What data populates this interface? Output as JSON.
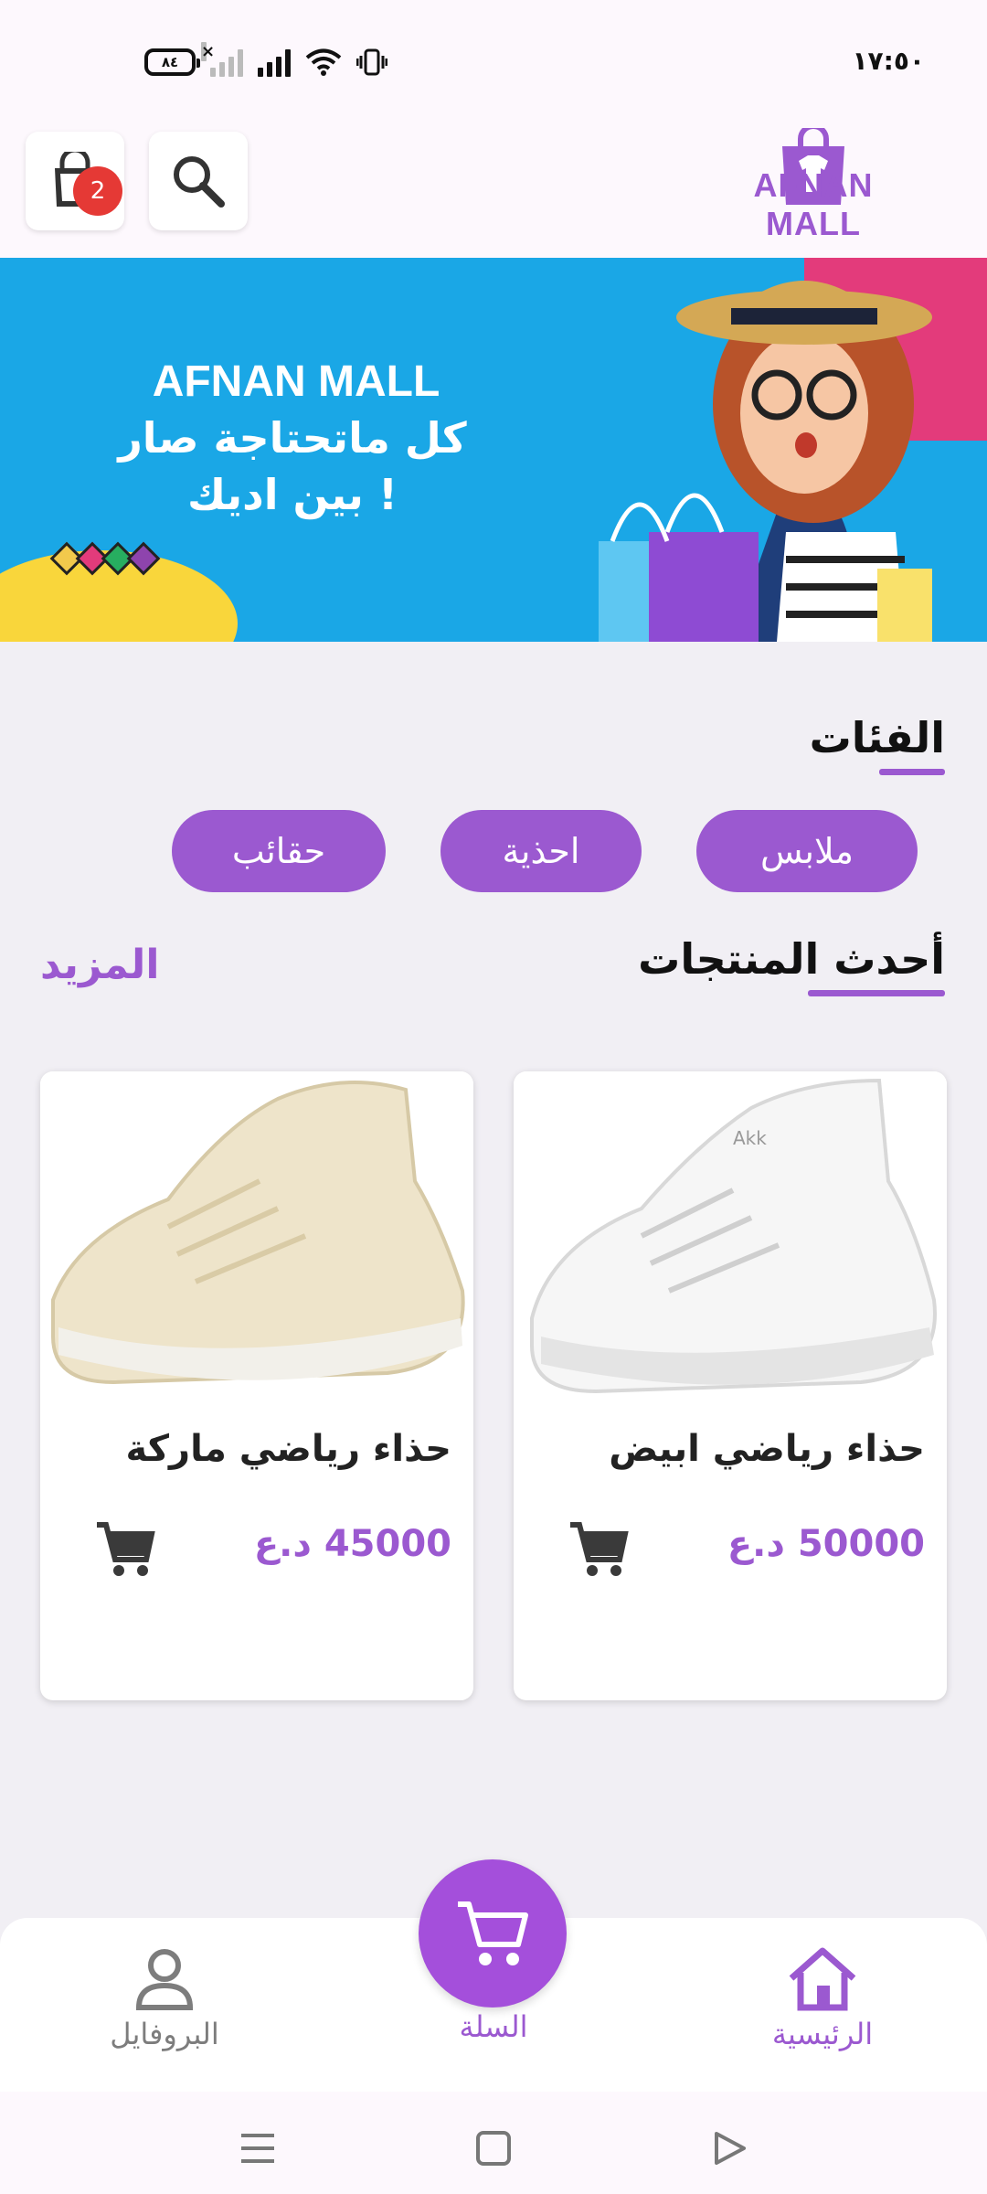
{
  "status_bar": {
    "battery": "٨٤",
    "time": "١٧:٥٠"
  },
  "header": {
    "logo_text": "AFNAN MALL",
    "cart_badge": "2",
    "icons": [
      "cart-icon",
      "search-icon"
    ]
  },
  "banner": {
    "title": "AFNAN MALL",
    "line1": "كل ماتحتاجة صار",
    "line2": "بين اديك !"
  },
  "categories": {
    "title": "الفئات",
    "items": [
      "ملابس",
      "احذية",
      "حقائب"
    ]
  },
  "latest": {
    "title": "أحدث المنتجات",
    "more": "المزيد"
  },
  "products": [
    {
      "name": "حذاء رياضي ابيض",
      "price": "50000 د.ع",
      "color": "#f4f4f4"
    },
    {
      "name": "حذاء رياضي ماركة",
      "price": "45000 د.ع",
      "color": "#ece3cf"
    }
  ],
  "bottom_nav": {
    "home": "الرئيسية",
    "cart": "السلة",
    "profile": "البروفايل"
  },
  "colors": {
    "accent": "#9b59d0",
    "badge": "#e53935"
  }
}
